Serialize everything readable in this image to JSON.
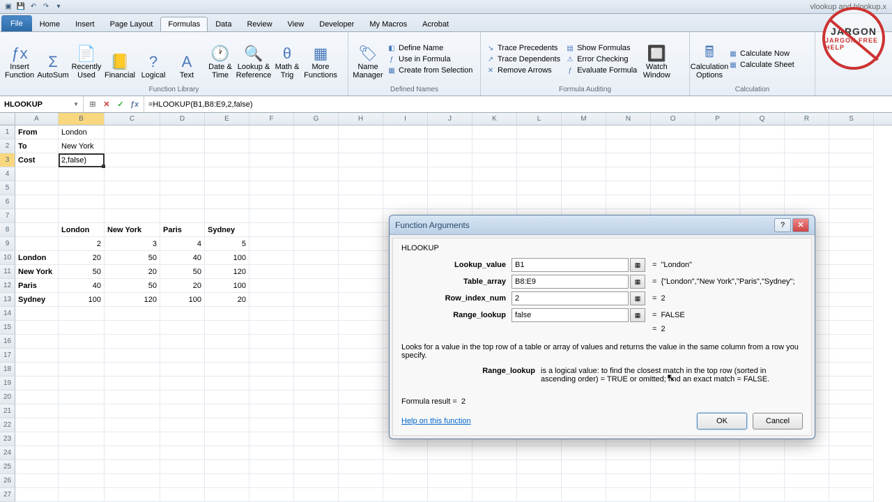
{
  "titlebar": {
    "filename": "vlookup and hlookup.x"
  },
  "tabs": {
    "file": "File",
    "home": "Home",
    "insert": "Insert",
    "pageLayout": "Page Layout",
    "formulas": "Formulas",
    "data": "Data",
    "review": "Review",
    "view": "View",
    "developer": "Developer",
    "myMacros": "My Macros",
    "acrobat": "Acrobat"
  },
  "ribbon": {
    "groups": {
      "funcLib": {
        "label": "Function Library",
        "insertFn": "Insert Function",
        "autosum": "AutoSum",
        "recent": "Recently Used",
        "financial": "Financial",
        "logical": "Logical",
        "text": "Text",
        "datetime": "Date & Time",
        "lookup": "Lookup & Reference",
        "math": "Math & Trig",
        "more": "More Functions"
      },
      "names": {
        "label": "Defined Names",
        "manager": "Name Manager",
        "define": "Define Name",
        "useIn": "Use in Formula",
        "create": "Create from Selection"
      },
      "audit": {
        "label": "Formula Auditing",
        "tracePrec": "Trace Precedents",
        "traceDep": "Trace Dependents",
        "removeArr": "Remove Arrows",
        "showForm": "Show Formulas",
        "errCheck": "Error Checking",
        "evalForm": "Evaluate Formula",
        "watch": "Watch Window"
      },
      "calc": {
        "label": "Calculation",
        "options": "Calculation Options",
        "now": "Calculate Now",
        "sheet": "Calculate Sheet"
      }
    }
  },
  "formulaBar": {
    "nameBox": "HLOOKUP",
    "formula": "=HLOOKUP(B1,B8:E9,2,false)"
  },
  "grid": {
    "cols": [
      "A",
      "B",
      "C",
      "D",
      "E",
      "F",
      "G",
      "H",
      "I",
      "J",
      "K",
      "L",
      "M",
      "N",
      "O",
      "P",
      "Q",
      "R",
      "S"
    ],
    "activeCol": "B",
    "activeRow": 3,
    "cells": {
      "A1": "From",
      "B1": "London",
      "A2": "To",
      "B2": "New York",
      "A3": "Cost",
      "B3": "2,false)",
      "B8": "London",
      "C8": "New York",
      "D8": "Paris",
      "E8": "Sydney",
      "B9": "2",
      "C9": "3",
      "D9": "4",
      "E9": "5",
      "A10": "London",
      "B10": "20",
      "C10": "50",
      "D10": "40",
      "E10": "100",
      "A11": "New York",
      "B11": "50",
      "C11": "20",
      "D11": "50",
      "E11": "120",
      "A12": "Paris",
      "B12": "40",
      "C12": "50",
      "D12": "20",
      "E12": "100",
      "A13": "Sydney",
      "B13": "100",
      "C13": "120",
      "D13": "100",
      "E13": "20"
    }
  },
  "dialog": {
    "title": "Function Arguments",
    "function": "HLOOKUP",
    "args": [
      {
        "label": "Lookup_value",
        "value": "B1",
        "result": "\"London\""
      },
      {
        "label": "Table_array",
        "value": "B8:E9",
        "result": "{\"London\",\"New York\",\"Paris\",\"Sydney\";"
      },
      {
        "label": "Row_index_num",
        "value": "2",
        "result": "2"
      },
      {
        "label": "Range_lookup",
        "value": "false",
        "result": "FALSE"
      }
    ],
    "overallResult": "2",
    "description": "Looks for a value in the top row of a table or array of values and returns the value in the same column from a row you specify.",
    "argHelp": {
      "label": "Range_lookup",
      "text": "is a logical value: to find the closest match in the top row (sorted in ascending order) = TRUE or omitted; find an exact match = FALSE."
    },
    "formulaResultLabel": "Formula result =",
    "formulaResultValue": "2",
    "helpLink": "Help on this function",
    "ok": "OK",
    "cancel": "Cancel"
  },
  "logo": {
    "top": "JARGON",
    "bottom": "JARGON FREE HELP"
  }
}
